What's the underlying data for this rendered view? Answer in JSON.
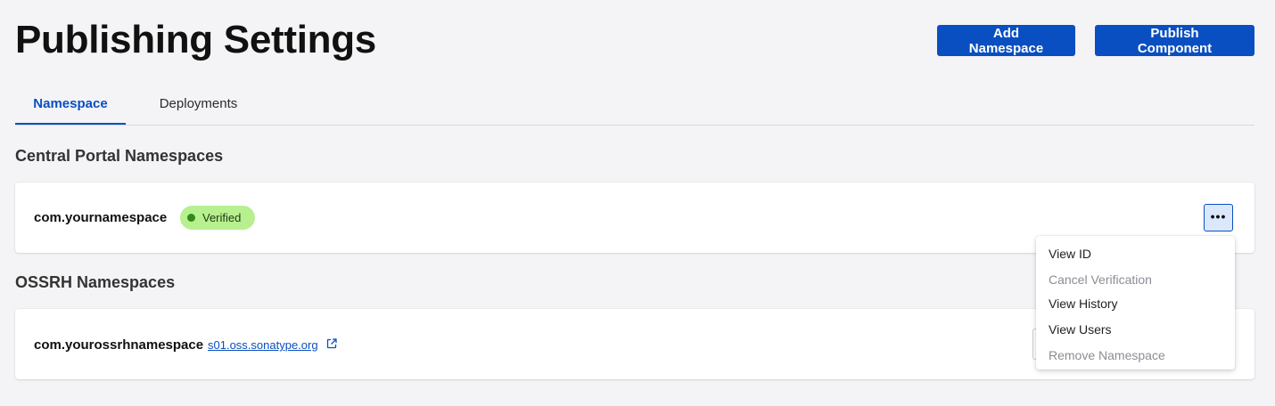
{
  "header": {
    "title": "Publishing Settings",
    "add_namespace_label": "Add Namespace",
    "publish_component_label": "Publish Component"
  },
  "tabs": [
    {
      "label": "Namespace",
      "active": true
    },
    {
      "label": "Deployments",
      "active": false
    }
  ],
  "central": {
    "section_title": "Central Portal Namespaces",
    "namespace": "com.yournamespace",
    "status": "Verified",
    "more_label": "•••"
  },
  "ossrh": {
    "section_title": "OSSRH Namespaces",
    "namespace": "com.yourossrhnamespace",
    "link_text": "s01.oss.sonatype.org"
  },
  "menu": {
    "items": [
      {
        "label": "View ID",
        "enabled": true
      },
      {
        "label": "Cancel Verification",
        "enabled": false
      },
      {
        "label": "View History",
        "enabled": true
      },
      {
        "label": "View Users",
        "enabled": true
      },
      {
        "label": "Remove Namespace",
        "enabled": false
      }
    ]
  },
  "colors": {
    "accent": "#0a4fc1",
    "verified_bg": "#b7f08f",
    "verified_dot": "#2f8a1a",
    "page_bg": "#f4f4f6"
  },
  "icons": {
    "external_link": "external-link-icon",
    "more": "more-horizontal-icon"
  }
}
